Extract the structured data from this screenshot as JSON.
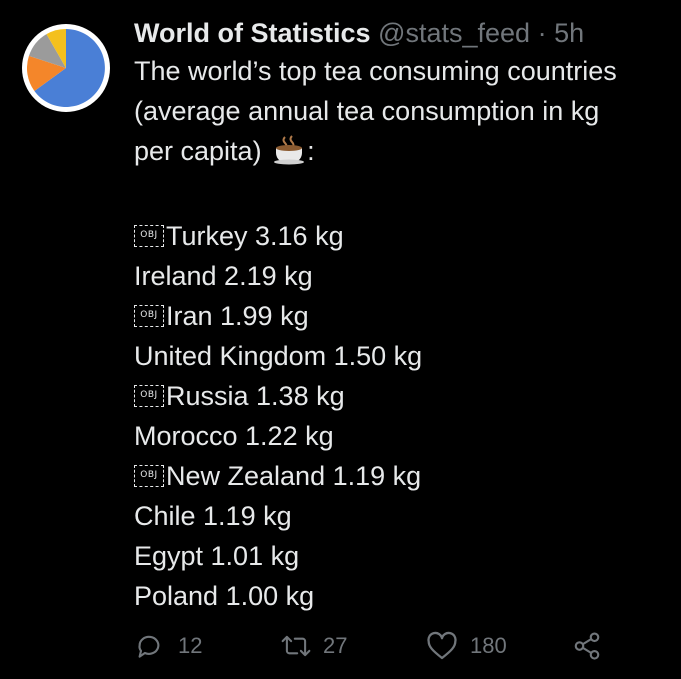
{
  "tweet": {
    "author_name": "World of Statistics",
    "handle": "@stats_feed",
    "separator": "·",
    "time": "5h",
    "intro_line1": "The world’s top tea consuming countries",
    "intro_line2": "(average annual tea consumption in kg",
    "intro_line3": "per capita)",
    "intro_suffix": ":",
    "obj_placeholder": "OBJ",
    "rows": [
      {
        "text": "Turkey 3.16 kg"
      },
      {
        "text": "Ireland 2.19 kg"
      },
      {
        "text": "Iran 1.99 kg"
      },
      {
        "text": "United Kingdom 1.50 kg"
      },
      {
        "text": "Russia 1.38 kg"
      },
      {
        "text": "Morocco 1.22 kg"
      },
      {
        "text": "New Zealand 1.19 kg"
      },
      {
        "text": "Chile 1.19 kg"
      },
      {
        "text": "Egypt 1.01 kg"
      },
      {
        "text": "Poland 1.00 kg"
      }
    ]
  },
  "actions": {
    "reply_count": "12",
    "retweet_count": "27",
    "like_count": "180"
  },
  "icons": {
    "avatar": "pie-chart-icon",
    "emoji": "tea-cup-icon",
    "reply": "speech-bubble-icon",
    "retweet": "retweet-arrows-icon",
    "like": "heart-icon",
    "share": "share-nodes-icon"
  },
  "colors": {
    "background": "#000000",
    "text": "#e7e9ea",
    "muted": "#71767b",
    "pie_blue": "#4a7fd6",
    "pie_orange": "#f4862a",
    "pie_gray": "#9b9b9b",
    "pie_yellow": "#f4c01e"
  }
}
